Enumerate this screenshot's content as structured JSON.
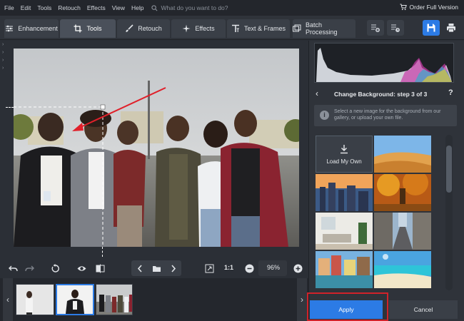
{
  "menu": {
    "items": [
      "File",
      "Edit",
      "Tools",
      "Retouch",
      "Effects",
      "View",
      "Help"
    ],
    "search_placeholder": "What do you want to do?",
    "order": "Order Full Version"
  },
  "tabs": [
    {
      "label": "Enhancement",
      "icon": "sliders-icon"
    },
    {
      "label": "Tools",
      "icon": "crop-icon",
      "active": true
    },
    {
      "label": "Retouch",
      "icon": "brush-icon"
    },
    {
      "label": "Effects",
      "icon": "sparkle-icon"
    },
    {
      "label": "Text & Frames",
      "icon": "text-icon"
    },
    {
      "label": "Batch Processing",
      "icon": "batch-icon"
    }
  ],
  "zoom": {
    "one_to_one": "1:1",
    "level": "96%"
  },
  "panel": {
    "step_title": "Change Background: step 3 of 3",
    "help": "?",
    "info": "Select a new image for the background from our gallery, or upload your own file.",
    "load_own": "Load My Own",
    "apply": "Apply",
    "cancel": "Cancel"
  },
  "colors": {
    "accent": "#2c7be5",
    "highlight": "#d0222a",
    "annotation_arrow": "#e0202a"
  }
}
